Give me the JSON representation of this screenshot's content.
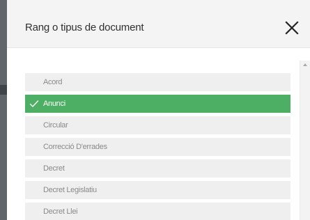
{
  "dialog": {
    "title": "Rang o tipus de document",
    "close_icon": "close-icon"
  },
  "options": [
    {
      "label": "Acord",
      "selected": false
    },
    {
      "label": "Anunci",
      "selected": true
    },
    {
      "label": "Circular",
      "selected": false
    },
    {
      "label": "Correcció D'errades",
      "selected": false
    },
    {
      "label": "Decret",
      "selected": false
    },
    {
      "label": "Decret Legislatiu",
      "selected": false
    },
    {
      "label": "Decret Llei",
      "selected": false
    }
  ],
  "colors": {
    "selected_bg": "#4caf63",
    "option_bg": "#efefef",
    "header_bg": "#f4f4f4"
  },
  "icons": {
    "selected_marker": "check-icon"
  }
}
